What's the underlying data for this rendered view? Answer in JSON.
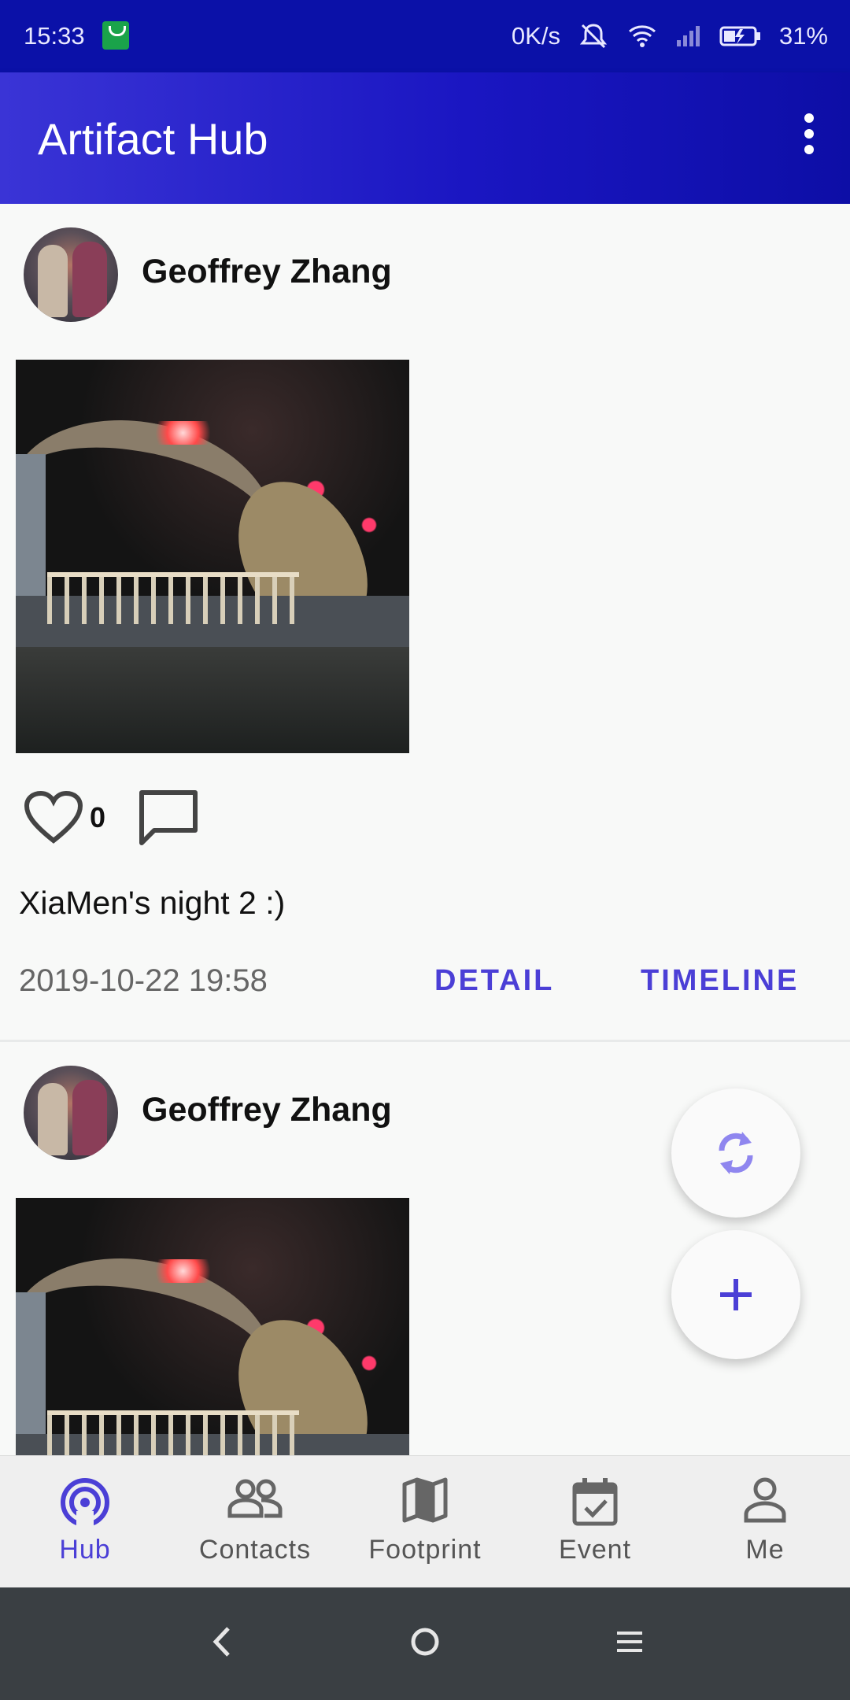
{
  "status_bar": {
    "time": "15:33",
    "net_speed": "0K/s",
    "battery": "31%"
  },
  "app_bar": {
    "title": "Artifact Hub",
    "menu_icon": "more-vert-icon"
  },
  "posts": [
    {
      "author": "Geoffrey Zhang",
      "likes": "0",
      "caption": "XiaMen's night 2 :)",
      "timestamp": "2019-10-22 19:58",
      "detail_label": "DETAIL",
      "timeline_label": "TIMELINE"
    },
    {
      "author": "Geoffrey Zhang"
    }
  ],
  "fabs": {
    "refresh_icon": "refresh-icon",
    "add_icon": "add-icon"
  },
  "bottom_nav": {
    "items": [
      {
        "label": "Hub",
        "icon": "hub-icon",
        "active": true
      },
      {
        "label": "Contacts",
        "icon": "contacts-icon",
        "active": false
      },
      {
        "label": "Footprint",
        "icon": "map-icon",
        "active": false
      },
      {
        "label": "Event",
        "icon": "event-icon",
        "active": false
      },
      {
        "label": "Me",
        "icon": "person-icon",
        "active": false
      }
    ]
  },
  "colors": {
    "primary": "#1a16c2",
    "accent": "#4b3fd6",
    "status_bar": "#0b11a8"
  }
}
